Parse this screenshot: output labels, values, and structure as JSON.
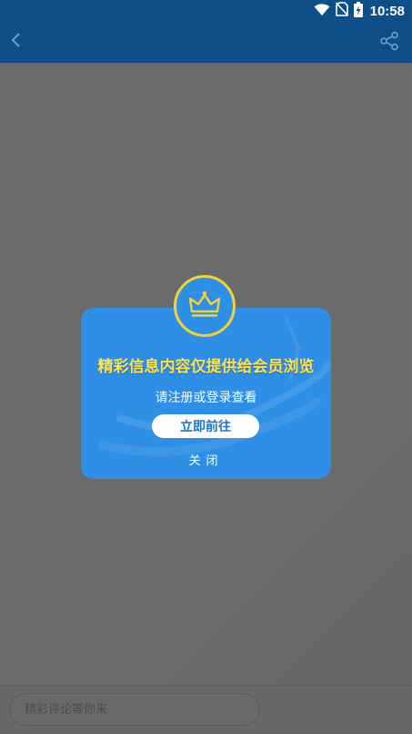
{
  "status_bar": {
    "time": "10:58",
    "icons": [
      "wifi-icon",
      "no-sim-icon",
      "battery-charging-icon"
    ]
  },
  "app_bar": {
    "back_icon": "chevron-left-icon",
    "share_icon": "share-icon"
  },
  "comment_bar": {
    "placeholder": "精彩评论等你来",
    "value": ""
  },
  "dialog": {
    "badge_icon": "crown-icon",
    "title": "精彩信息内容仅提供给会员浏览",
    "subtitle": "请注册或登录查看",
    "primary_button": "立即前往",
    "close_label": "关闭"
  },
  "colors": {
    "app_bar": "#0f4f87",
    "dialog_bg": "#2f8ee6",
    "title": "#ffe14a",
    "badge_ring": "#f2d23c"
  }
}
